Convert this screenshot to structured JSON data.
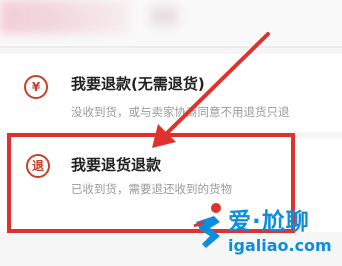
{
  "options": [
    {
      "icon": "refund-icon",
      "glyph": "¥",
      "title": "我要退款(无需退货)",
      "desc": "没收到货，或与卖家协商同意不用退货只退"
    },
    {
      "icon": "return-icon",
      "glyph": "退",
      "title": "我要退货退款",
      "desc": "已收到货，需要退还收到的货物"
    }
  ],
  "watermark": {
    "title": "爱·尬聊",
    "url": "igaliao.com"
  },
  "colors": {
    "highlight": "#e0322d",
    "icon": "#c5402b",
    "watermark": "#0d8ddb"
  }
}
